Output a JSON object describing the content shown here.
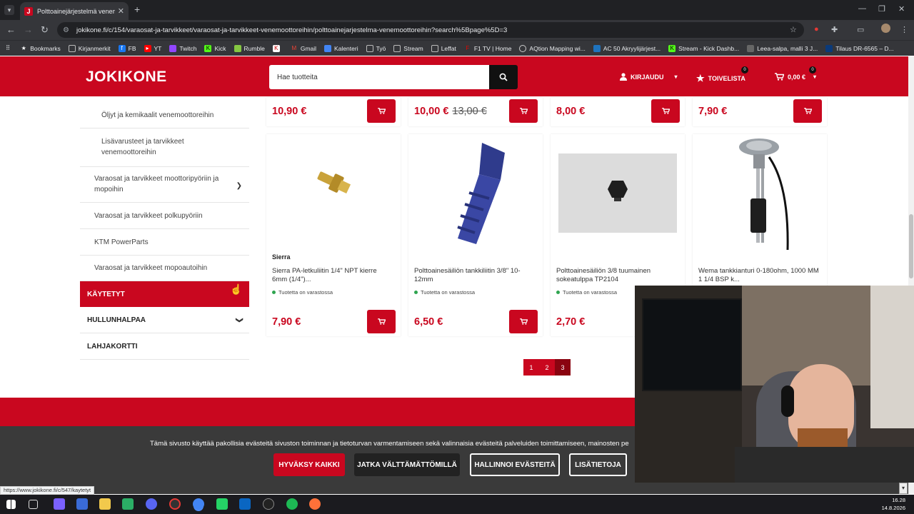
{
  "browser": {
    "tab_title": "Polttoainejärjestelmä venemoottoreihin",
    "favicon_letter": "J",
    "url": "jokikone.fi/c/154/varaosat-ja-tarvikkeet/varaosat-ja-tarvikkeet-venemoottoreihin/polttoainejarjestelma-venemoottoreihin?search%5Bpage%5D=3",
    "bookmarks": [
      "Bookmarks",
      "Kirjanmerkit",
      "FB",
      "YT",
      "Twitch",
      "Kick",
      "Rumble",
      "Gmail",
      "Kalenteri",
      "Työ",
      "Stream",
      "Leffat",
      "F1 TV | Home",
      "AQtion Mapping wi...",
      "AC 50 Akryylijärjest...",
      "Stream - Kick Dashb...",
      "Leea-salpa, malli 3 J...",
      "Tilaus DR-6565 – D..."
    ],
    "status_url": "https://www.jokikone.fi/c/547/kaytetyt"
  },
  "site": {
    "logo": "JOKIKONE",
    "search_placeholder": "Hae tuotteita",
    "login_label": "KIRJAUDU",
    "wishlist_label": "TOIVELISTA",
    "wishlist_count": "0",
    "cart_label": "0,00 €",
    "cart_count": "0"
  },
  "sidebar": {
    "sub_items": [
      "Öljyt ja kemikaalit venemoottoreihin",
      "Lisävarusteet ja tarvikkeet venemoottoreihin"
    ],
    "items": [
      "Varaosat ja tarvikkeet moottoripyöriin ja mopoihin",
      "Varaosat ja tarvikkeet polkupyöriin",
      "KTM PowerParts",
      "Varaosat ja tarvikkeet mopoautoihin"
    ],
    "top": [
      "KÄYTETYT",
      "HULLUNHALPAA",
      "LAHJAKORTTI"
    ]
  },
  "top_row_prices": [
    {
      "price": "10,90 €",
      "old": ""
    },
    {
      "price": "10,00 €",
      "old": "13,00 €"
    },
    {
      "price": "8,00 €",
      "old": ""
    },
    {
      "price": "7,90 €",
      "old": ""
    }
  ],
  "products": [
    {
      "brand": "Sierra",
      "name": "Sierra PA-letkuliitin 1/4\" NPT kierre 6mm (1/4\")...",
      "stock": "Tuotetta on varastossa",
      "price": "7,90 €"
    },
    {
      "brand": "",
      "name": "Polttoainesäiliön tankkiliitin 3/8\" 10-12mm",
      "stock": "Tuotetta on varastossa",
      "price": "6,50 €"
    },
    {
      "brand": "",
      "name": "Polttoainesäiliön 3/8 tuumainen sokeatulppa TP2104",
      "stock": "Tuotetta on varastossa",
      "price": "2,70 €"
    },
    {
      "brand": "",
      "name": "Wema tankkianturi 0-180ohm, 1000 MM 1 1/4 BSP k...",
      "stock": "",
      "price": ""
    }
  ],
  "pagination": [
    "1",
    "2",
    "3"
  ],
  "cookie": {
    "text": "Tämä sivusto käyttää pakollisia evästeitä sivuston toiminnan ja tietoturvan varmentamiseen sekä valinnaisia evästeitä palveluiden toimittamiseen, mainosten pe",
    "accept_all": "HYVÄKSY KAIKKI",
    "necessary": "JATKA VÄLTTÄMÄTTÖMILLÄ",
    "manage": "HALLINNOI EVÄSTEITÄ",
    "more": "LISÄTIETOJA"
  },
  "taskbar": {
    "time": "16.28",
    "date": "14.8.2026"
  }
}
